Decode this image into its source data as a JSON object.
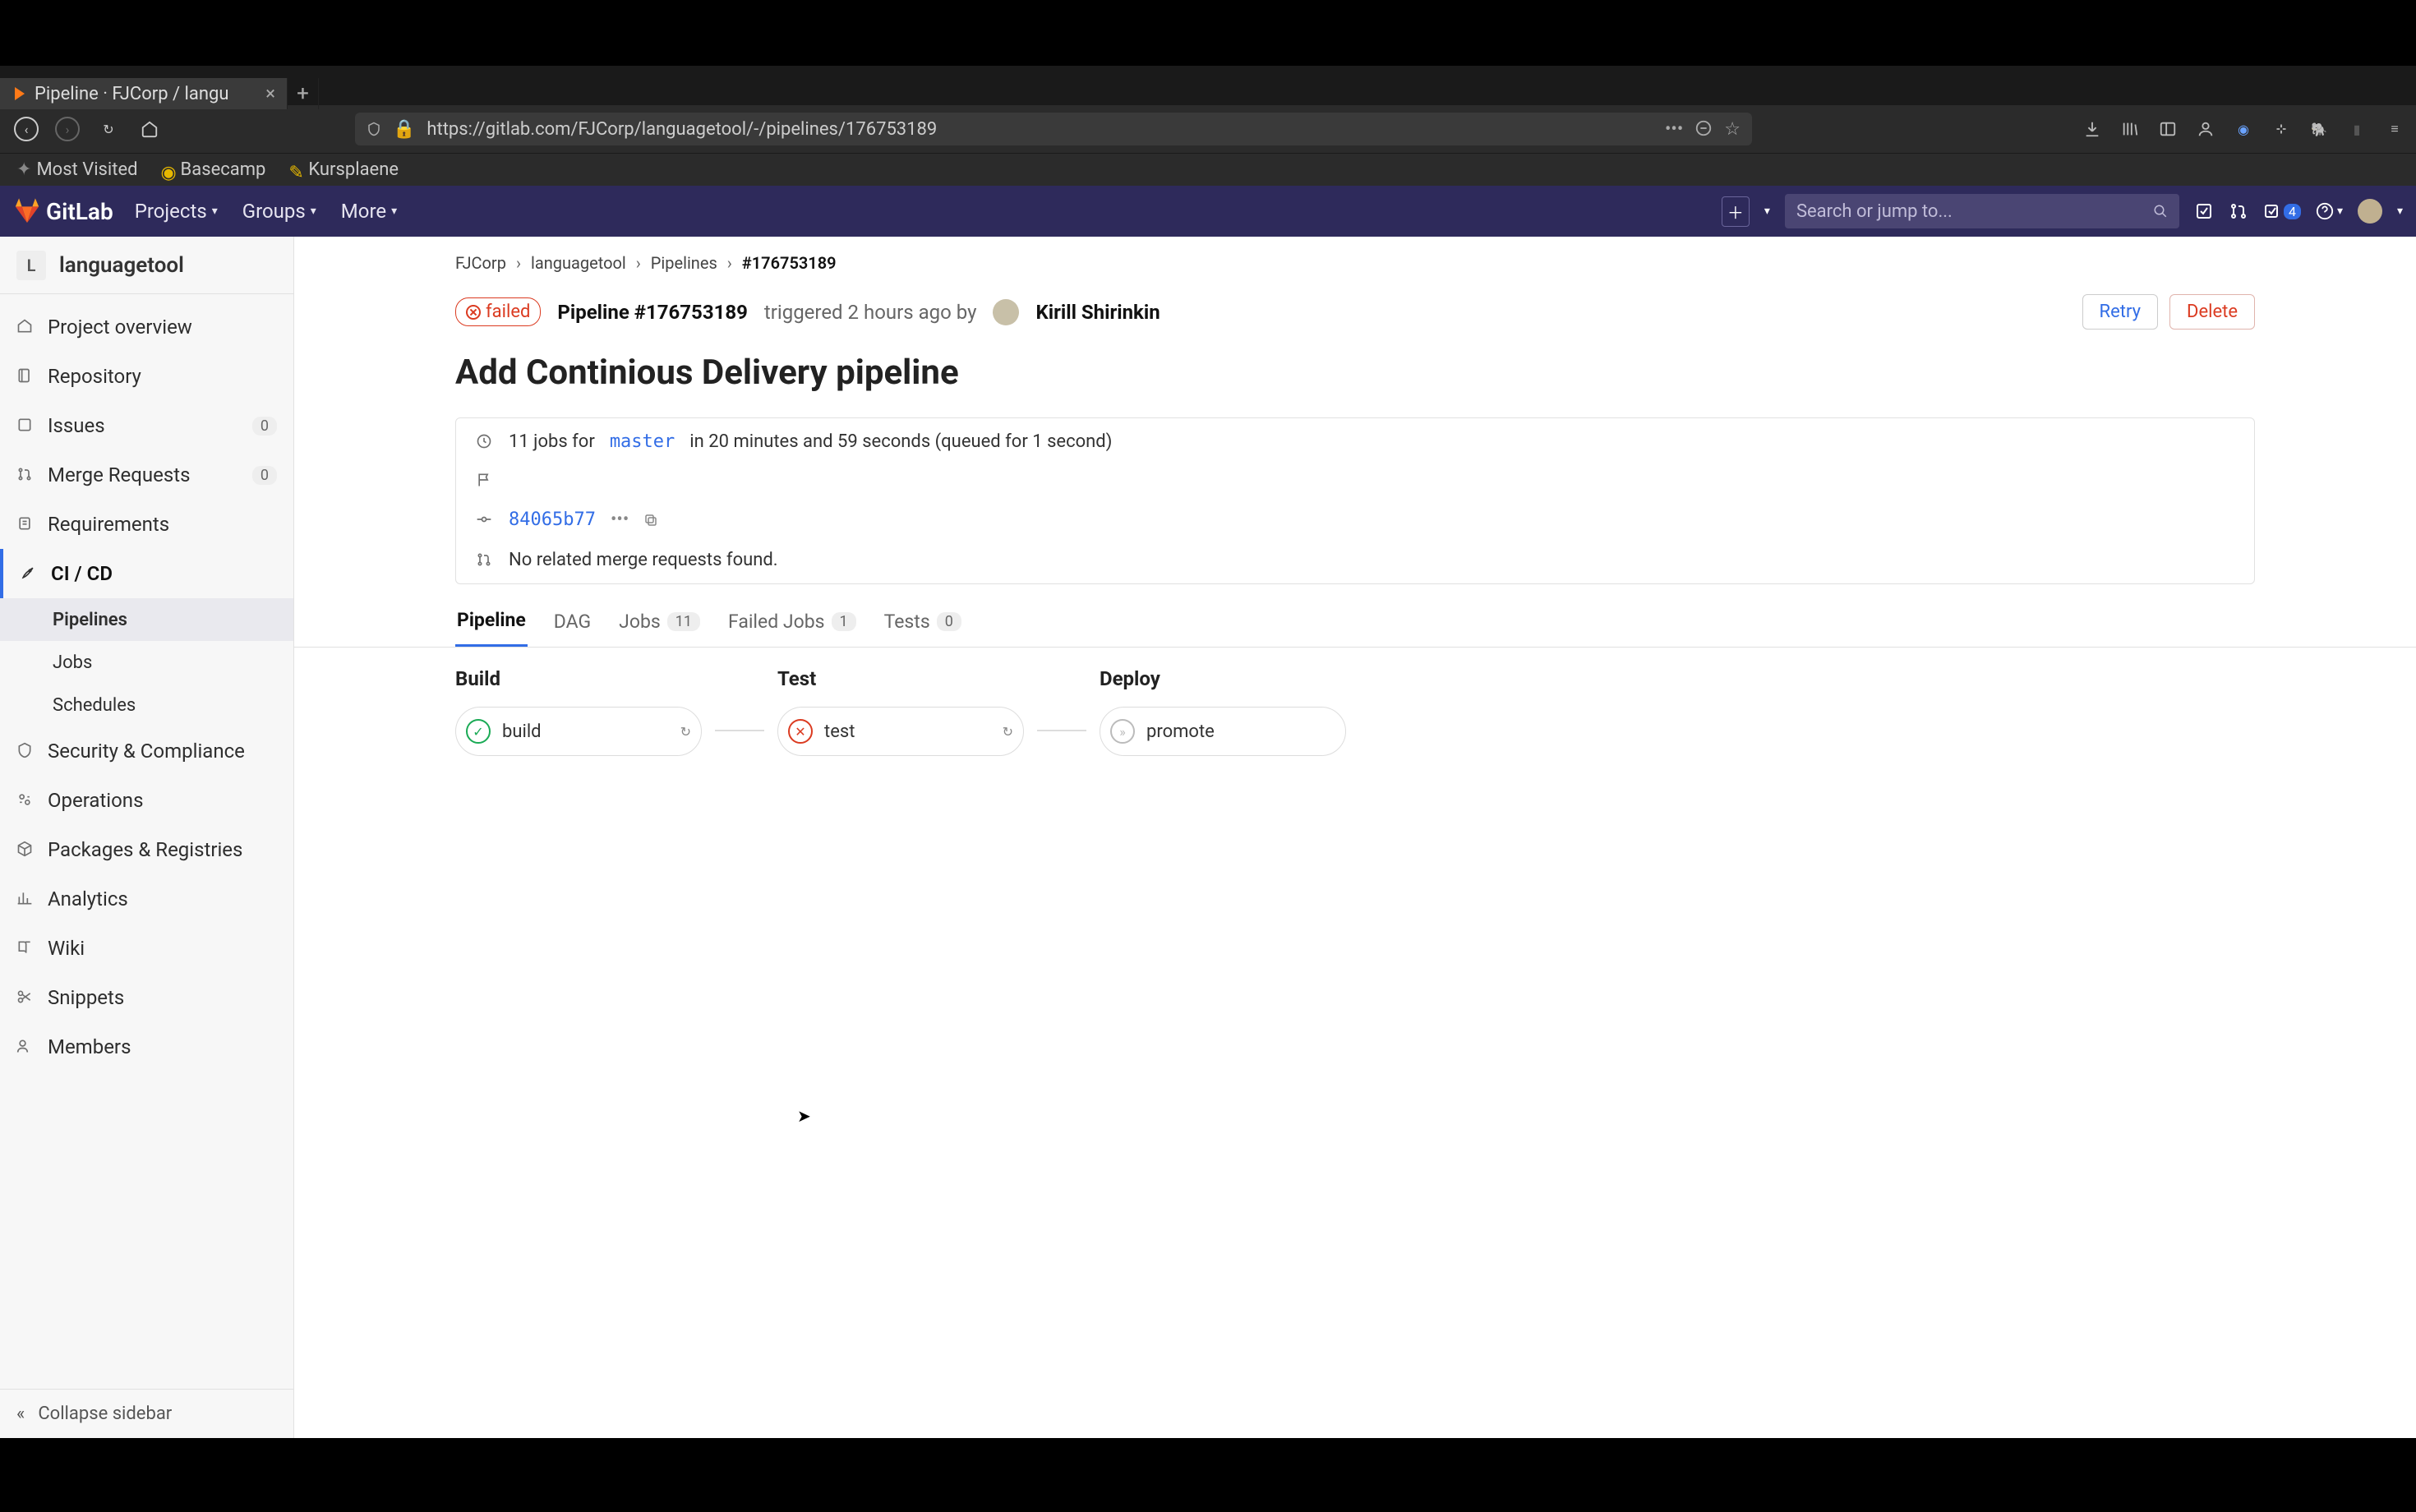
{
  "browser": {
    "tab_title": "Pipeline · FJCorp / langu",
    "url": "https://gitlab.com/FJCorp/languagetool/-/pipelines/176753189",
    "bookmarks": [
      "Most Visited",
      "Basecamp",
      "Kursplaene"
    ]
  },
  "nav": {
    "brand": "GitLab",
    "items": [
      "Projects",
      "Groups",
      "More"
    ],
    "search_placeholder": "Search or jump to...",
    "todo_count": "4"
  },
  "project": {
    "initial": "L",
    "name": "languagetool"
  },
  "sidebar": {
    "items": [
      {
        "label": "Project overview"
      },
      {
        "label": "Repository"
      },
      {
        "label": "Issues",
        "badge": "0"
      },
      {
        "label": "Merge Requests",
        "badge": "0"
      },
      {
        "label": "Requirements"
      },
      {
        "label": "CI / CD",
        "active": true
      },
      {
        "label": "Security & Compliance"
      },
      {
        "label": "Operations"
      },
      {
        "label": "Packages & Registries"
      },
      {
        "label": "Analytics"
      },
      {
        "label": "Wiki"
      },
      {
        "label": "Snippets"
      },
      {
        "label": "Members"
      }
    ],
    "cicd_sub": [
      "Pipelines",
      "Jobs",
      "Schedules"
    ],
    "collapse": "Collapse sidebar"
  },
  "breadcrumbs": {
    "group": "FJCorp",
    "project": "languagetool",
    "section": "Pipelines",
    "id": "#176753189"
  },
  "pipeline": {
    "status": "failed",
    "id_label": "Pipeline #176753189",
    "triggered_prefix": "triggered",
    "triggered_time": "2 hours ago",
    "by": "by",
    "author": "Kirill Shirinkin",
    "retry": "Retry",
    "delete": "Delete",
    "title": "Add Continious Delivery pipeline",
    "jobs_summary_pre": "11 jobs for",
    "branch": "master",
    "jobs_summary_post": "in 20 minutes and 59 seconds (queued for 1 second)",
    "sha": "84065b77",
    "no_mr": "No related merge requests found."
  },
  "tabs": {
    "pipeline": "Pipeline",
    "dag": "DAG",
    "jobs": "Jobs",
    "jobs_n": "11",
    "failed": "Failed Jobs",
    "failed_n": "1",
    "tests": "Tests",
    "tests_n": "0"
  },
  "stages": [
    {
      "name": "Build",
      "job": "build",
      "status": "pass",
      "retry": true
    },
    {
      "name": "Test",
      "job": "test",
      "status": "fail",
      "retry": true
    },
    {
      "name": "Deploy",
      "job": "promote",
      "status": "skip",
      "retry": false
    }
  ]
}
